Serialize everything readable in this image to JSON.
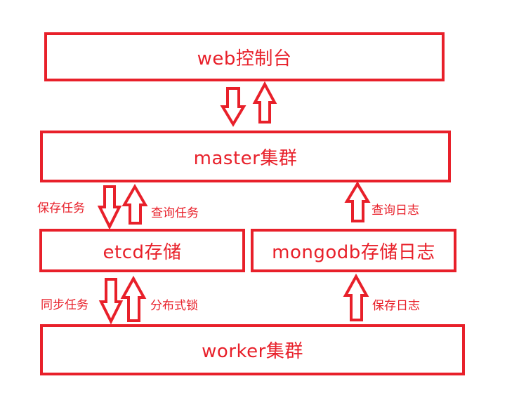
{
  "nodes": {
    "web_console": "web控制台",
    "master_cluster": "master集群",
    "etcd_storage": "etcd存储",
    "mongodb_storage": "mongodb存储日志",
    "worker_cluster": "worker集群"
  },
  "edges": {
    "save_task": "保存任务",
    "query_task": "查询任务",
    "sync_task": "同步任务",
    "distributed_lock": "分布式锁",
    "query_log": "查询日志",
    "save_log": "保存日志"
  },
  "colors": {
    "accent": "#e8202a"
  }
}
